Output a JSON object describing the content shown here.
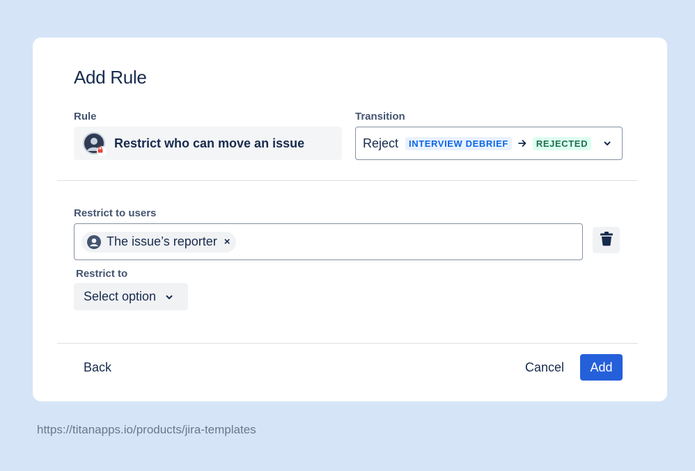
{
  "dialog": {
    "title": "Add Rule",
    "rule": {
      "label": "Rule",
      "value": "Restrict who can move an issue"
    },
    "transition": {
      "label": "Transition",
      "name": "Reject",
      "from_status": "INTERVIEW DEBRIEF",
      "to_status": "REJECTED",
      "from_color": "#0c66e4",
      "to_color": "#216e4e"
    },
    "restrict_users": {
      "label": "Restrict to users",
      "tags": [
        {
          "label": "The issue’s reporter",
          "icon": "user-circle-icon"
        }
      ],
      "remove_glyph": "×"
    },
    "restrict_to": {
      "label": "Restrict to",
      "select_value": "Select option"
    },
    "footer": {
      "back_label": "Back",
      "cancel_label": "Cancel",
      "add_label": "Add"
    },
    "accent_color": "#2560db"
  },
  "footer_url": "https://titanapps.io/products/jira-templates"
}
